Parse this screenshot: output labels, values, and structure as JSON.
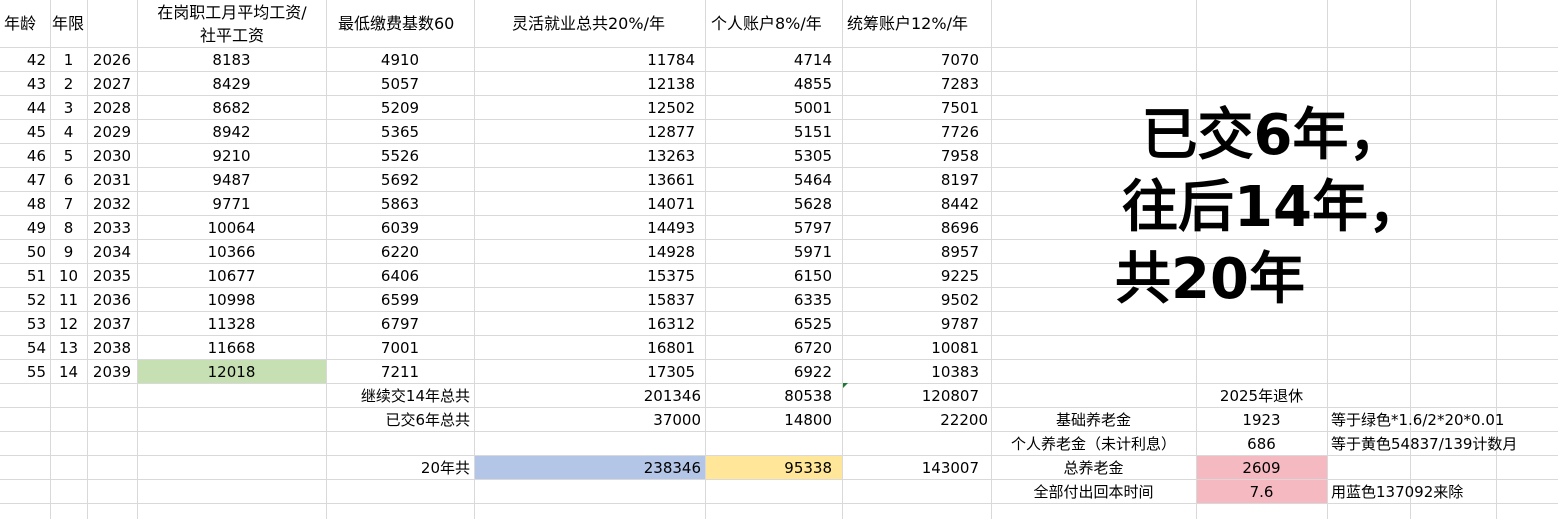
{
  "headers": {
    "age": "年龄",
    "term": "年限",
    "avg_wage_line1": "在岗职工月平均工资/",
    "avg_wage_line2": "社平工资",
    "min_base": "最低缴费基数60",
    "flex_total": "灵活就业总共20%/年",
    "personal": "个人账户8%/年",
    "pooled": "统筹账户12%/年"
  },
  "rows": [
    {
      "age": "42",
      "term": "1",
      "year": "2026",
      "wage": "8183",
      "base": "4910",
      "total": "11784",
      "personal": "4714",
      "pooled": "7070"
    },
    {
      "age": "43",
      "term": "2",
      "year": "2027",
      "wage": "8429",
      "base": "5057",
      "total": "12138",
      "personal": "4855",
      "pooled": "7283"
    },
    {
      "age": "44",
      "term": "3",
      "year": "2028",
      "wage": "8682",
      "base": "5209",
      "total": "12502",
      "personal": "5001",
      "pooled": "7501"
    },
    {
      "age": "45",
      "term": "4",
      "year": "2029",
      "wage": "8942",
      "base": "5365",
      "total": "12877",
      "personal": "5151",
      "pooled": "7726"
    },
    {
      "age": "46",
      "term": "5",
      "year": "2030",
      "wage": "9210",
      "base": "5526",
      "total": "13263",
      "personal": "5305",
      "pooled": "7958"
    },
    {
      "age": "47",
      "term": "6",
      "year": "2031",
      "wage": "9487",
      "base": "5692",
      "total": "13661",
      "personal": "5464",
      "pooled": "8197"
    },
    {
      "age": "48",
      "term": "7",
      "year": "2032",
      "wage": "9771",
      "base": "5863",
      "total": "14071",
      "personal": "5628",
      "pooled": "8442"
    },
    {
      "age": "49",
      "term": "8",
      "year": "2033",
      "wage": "10064",
      "base": "6039",
      "total": "14493",
      "personal": "5797",
      "pooled": "8696"
    },
    {
      "age": "50",
      "term": "9",
      "year": "2034",
      "wage": "10366",
      "base": "6220",
      "total": "14928",
      "personal": "5971",
      "pooled": "8957"
    },
    {
      "age": "51",
      "term": "10",
      "year": "2035",
      "wage": "10677",
      "base": "6406",
      "total": "15375",
      "personal": "6150",
      "pooled": "9225"
    },
    {
      "age": "52",
      "term": "11",
      "year": "2036",
      "wage": "10998",
      "base": "6599",
      "total": "15837",
      "personal": "6335",
      "pooled": "9502"
    },
    {
      "age": "53",
      "term": "12",
      "year": "2037",
      "wage": "11328",
      "base": "6797",
      "total": "16312",
      "personal": "6525",
      "pooled": "9787"
    },
    {
      "age": "54",
      "term": "13",
      "year": "2038",
      "wage": "11668",
      "base": "7001",
      "total": "16801",
      "personal": "6720",
      "pooled": "10081"
    },
    {
      "age": "55",
      "term": "14",
      "year": "2039",
      "wage": "12018",
      "base": "7211",
      "total": "17305",
      "personal": "6922",
      "pooled": "10383"
    }
  ],
  "summary": {
    "cont14_label": "继续交14年总共",
    "cont14_total": "201346",
    "cont14_personal": "80538",
    "cont14_pooled": "120807",
    "paid6_label": "已交6年总共",
    "paid6_total": "37000",
    "paid6_personal": "14800",
    "paid6_pooled": "22200",
    "all20_label": "20年共",
    "all20_total": "238346",
    "all20_personal": "95338",
    "all20_pooled": "143007"
  },
  "pension": {
    "retire_label": "2025年退休",
    "basic_label": "基础养老金",
    "basic_value": "1923",
    "basic_note": "等于绿色*1.6/2*20*0.01",
    "personal_label": "个人养老金（未计利息）",
    "personal_value": "686",
    "personal_note": "等于黄色54837/139计数月",
    "total_label": "总养老金",
    "total_value": "2609",
    "payback_label": "全部付出回本时间",
    "payback_value": "7.6",
    "payback_note": "用蓝色137092来除"
  },
  "big_text": {
    "line1": "已交6年，",
    "line2": "往后14年，",
    "line3": "共20年"
  },
  "colors": {
    "green_cell": "#c6e0b4",
    "blue_cell": "#b4c6e7",
    "yellow_cell": "#ffe699",
    "pink_cell": "#f4b9c1",
    "gridline": "#d9d9d9"
  }
}
